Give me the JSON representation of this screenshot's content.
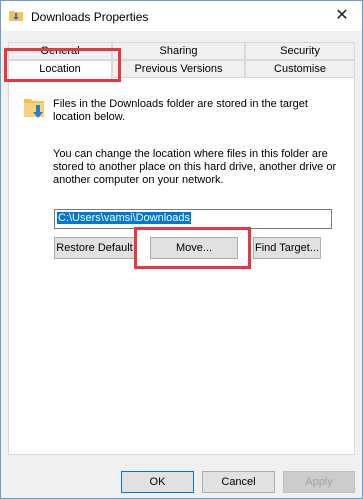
{
  "window": {
    "title": "Downloads Properties",
    "close_glyph": "✕"
  },
  "tabs": {
    "row1": [
      "General",
      "Sharing",
      "Security"
    ],
    "row2": [
      "Location",
      "Previous Versions",
      "Customise"
    ],
    "active": "Location"
  },
  "location": {
    "info_line1": "Files in the Downloads folder are stored in the target",
    "info_line2": "location below.",
    "desc_line1": "You can change the location where files in this folder are",
    "desc_line2": "stored to another place on this hard drive, another drive or",
    "desc_line3": "another computer on your network.",
    "path_value": "C:\\Users\\vamsi\\Downloads",
    "restore_default_label": "Restore Default",
    "move_label": "Move...",
    "find_target_label": "Find Target..."
  },
  "footer": {
    "ok_label": "OK",
    "cancel_label": "Cancel",
    "apply_label": "Apply"
  },
  "icons": {
    "title_icon": "folder-download-icon",
    "panel_icon": "folder-download-icon",
    "close": "close-icon"
  },
  "colors": {
    "highlight": "#e8373f",
    "selection": "#0078d7",
    "folder": "#f4c152",
    "arrow": "#2b79d2"
  }
}
